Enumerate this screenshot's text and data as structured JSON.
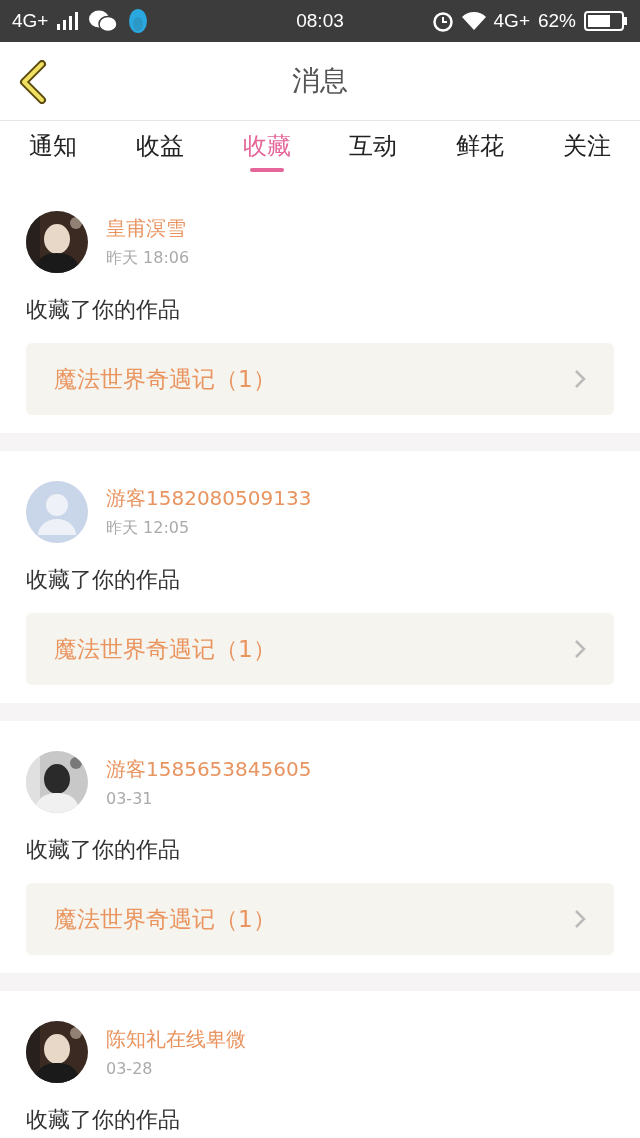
{
  "status_bar": {
    "network_left": "4G+",
    "time": "08:03",
    "network_right": "4G+",
    "battery": "62%"
  },
  "header": {
    "back": true,
    "title": "消息"
  },
  "tabs": [
    {
      "label": "通知",
      "selected": false
    },
    {
      "label": "收益",
      "selected": false
    },
    {
      "label": "收藏",
      "selected": true
    },
    {
      "label": "互动",
      "selected": false
    },
    {
      "label": "鲜花",
      "selected": false
    },
    {
      "label": "关注",
      "selected": false
    }
  ],
  "messages": [
    {
      "name": "皇甫溟雪",
      "time": "昨天 18:06",
      "text": "收藏了你的作品",
      "work": "魔法世界奇遇记（1）"
    },
    {
      "avatar": {
        "kind": "default"
      },
      "name": "游客1582080509133",
      "time": "昨天 12:05",
      "text": "收藏了你的作品",
      "work": "魔法世界奇遇记（1）"
    },
    {
      "name": "游客1585653845605",
      "time": "03-31",
      "text": "收藏了你的作品",
      "work": "魔法世界奇遇记（1）"
    },
    {
      "name": "陈知礼在线卑微",
      "time": "03-28",
      "text": "收藏了你的作品"
    }
  ]
}
